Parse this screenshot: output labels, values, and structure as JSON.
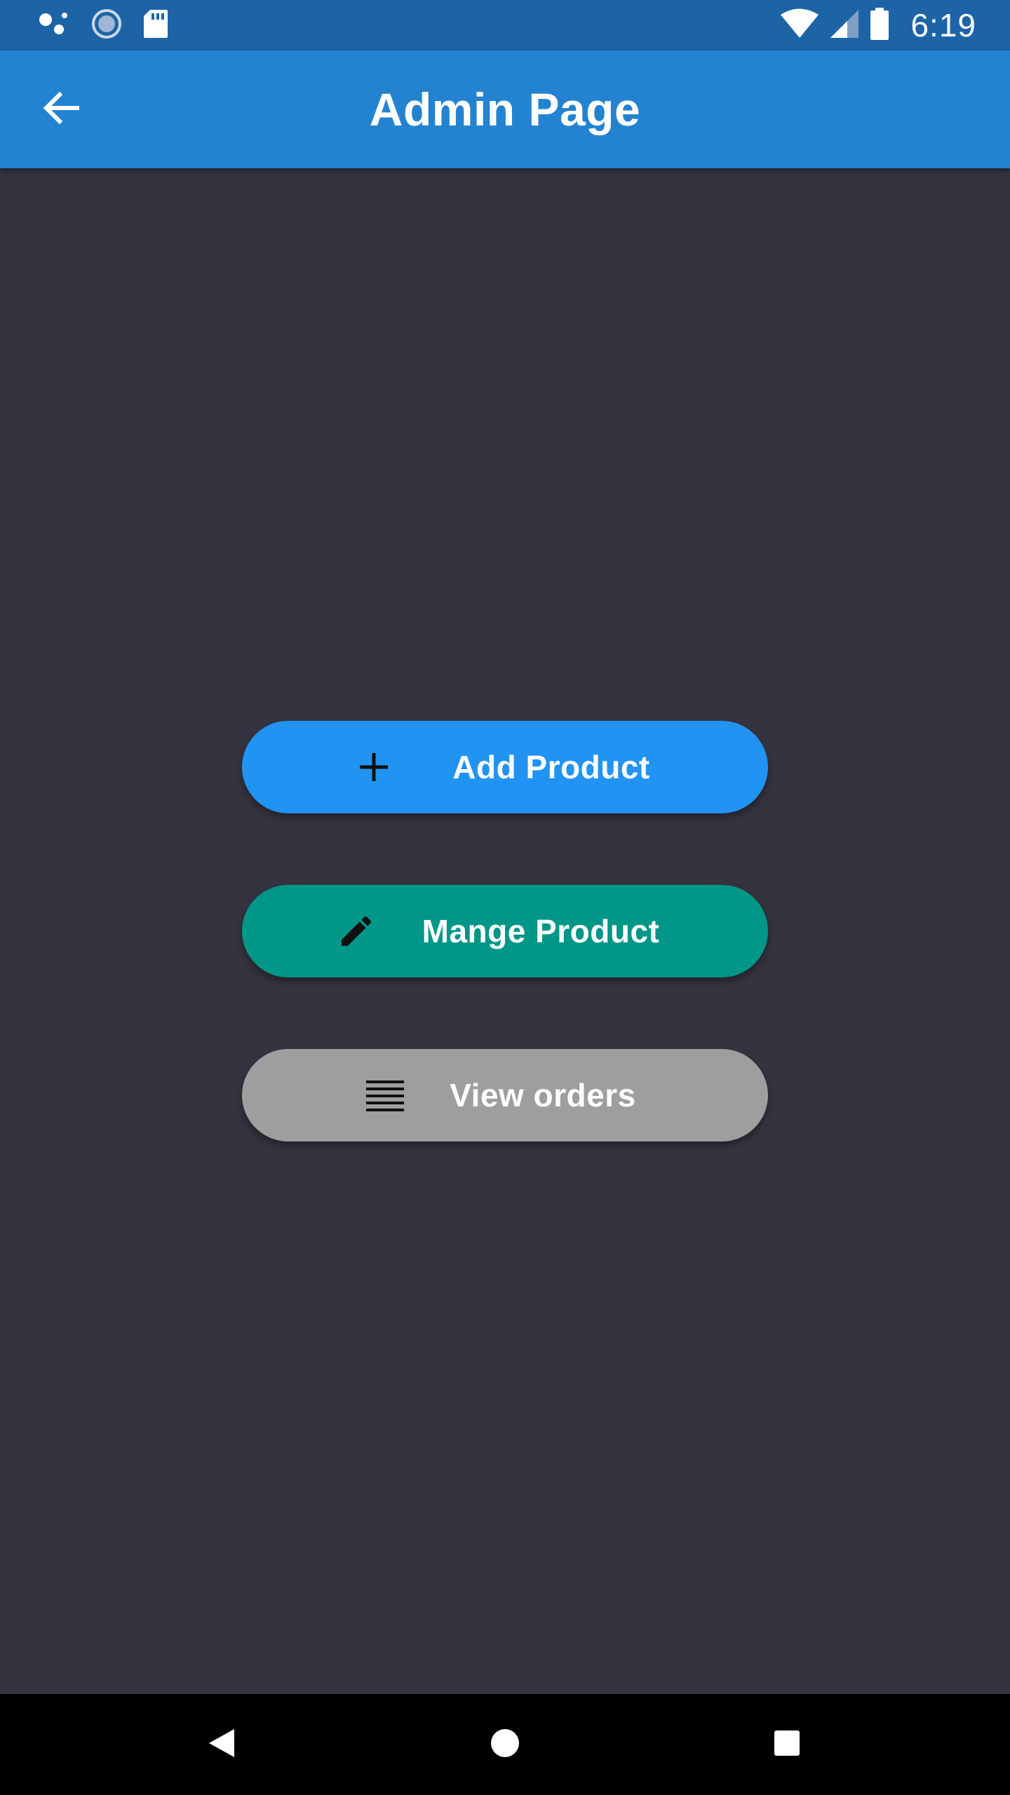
{
  "status_bar": {
    "time": "6:19",
    "icons": [
      "assistant-dots-icon",
      "sync-circle-icon",
      "sd-card-icon",
      "wifi-icon",
      "cell-signal-icon",
      "battery-icon"
    ]
  },
  "app_bar": {
    "title": "Admin Page",
    "back_icon": "arrow-back-icon"
  },
  "actions": [
    {
      "label": "Add Product",
      "icon": "plus-icon",
      "color": "#2193f3"
    },
    {
      "label": "Mange Product",
      "icon": "pencil-icon",
      "color": "#009688"
    },
    {
      "label": "View orders",
      "icon": "list-lines-icon",
      "color": "#9e9e9e"
    }
  ],
  "nav_bar": {
    "icons": [
      "nav-back-icon",
      "nav-home-icon",
      "nav-recents-icon"
    ]
  },
  "colors": {
    "status_bar": "#1c64a6",
    "app_bar": "#2483d0",
    "background": "#35333f"
  }
}
